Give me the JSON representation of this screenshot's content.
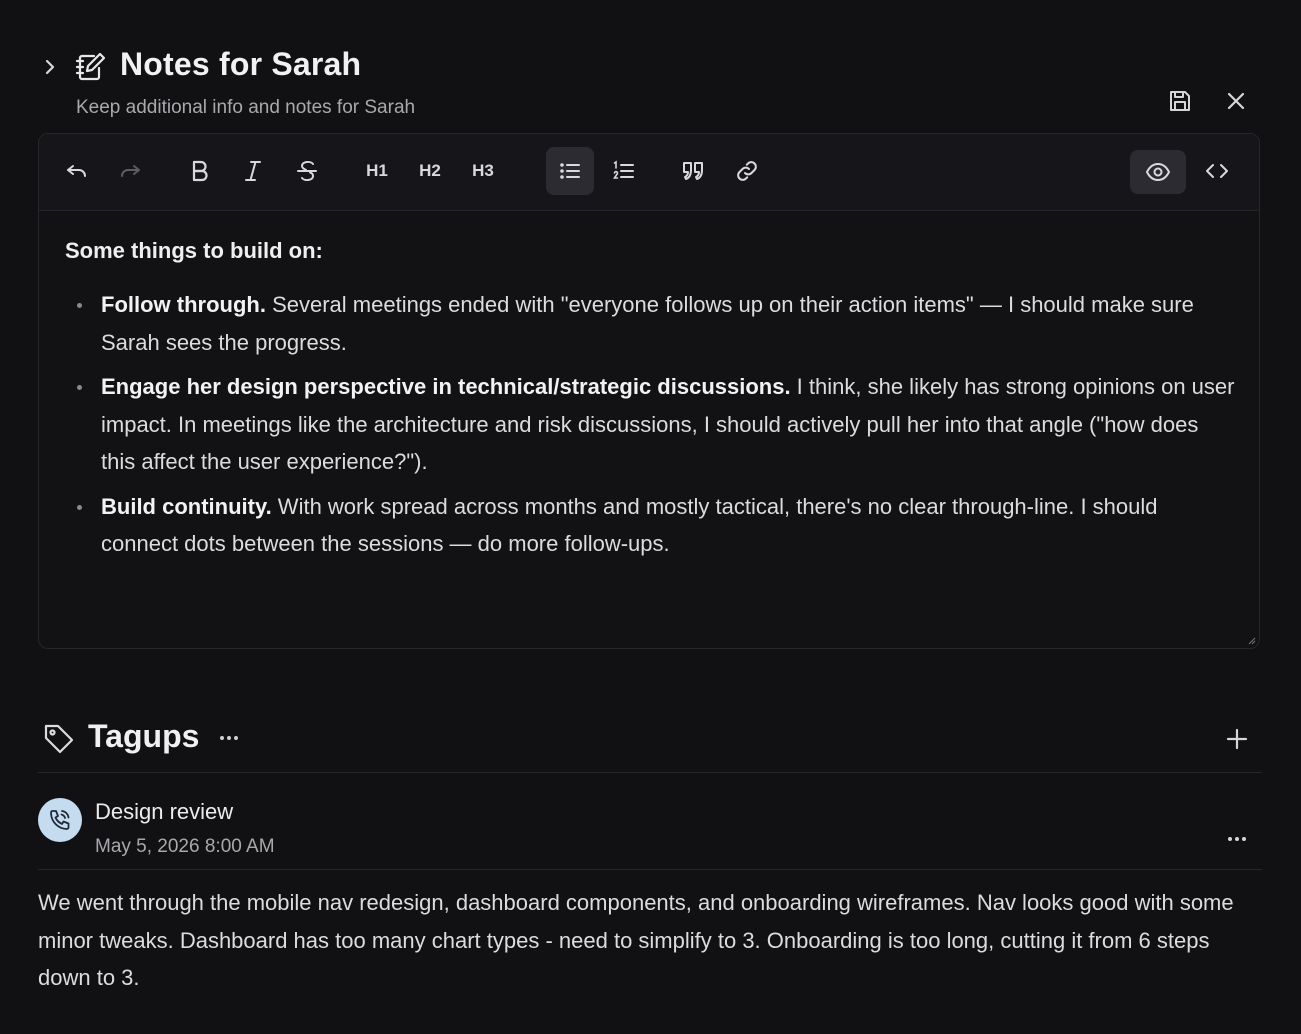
{
  "header": {
    "title": "Notes for Sarah",
    "subtitle": "Keep additional info and notes for Sarah"
  },
  "toolbar": {
    "h1": "H1",
    "h2": "H2",
    "h3": "H3"
  },
  "editor": {
    "lead": "Some things to build on:",
    "bullets": [
      {
        "bold": "Follow through.",
        "text": " Several meetings ended with \"everyone follows up on their action items\" — I should make sure Sarah sees the progress."
      },
      {
        "bold": "Engage her design perspective in technical/strategic discussions.",
        "text": " I think, she likely has strong opinions on user impact. In meetings like the architecture and risk discussions, I should actively pull her into that angle (\"how does this affect the user experience?\")."
      },
      {
        "bold": "Build continuity.",
        "text": " With work spread across months and mostly tactical, there's no clear through-line. I should connect dots between the sessions — do more follow-ups."
      }
    ]
  },
  "tagups": {
    "title": "Tagups",
    "items": [
      {
        "title": "Design review",
        "date": "May 5, 2026 8:00 AM",
        "body": "We went through the mobile nav redesign, dashboard components, and onboarding wireframes. Nav looks good with some minor tweaks. Dashboard has too many chart types - need to simplify to 3. Onboarding is too long, cutting it from 6 steps down to 3."
      }
    ]
  },
  "colors": {
    "background": "#111114",
    "avatar": "#c5dcf0"
  }
}
